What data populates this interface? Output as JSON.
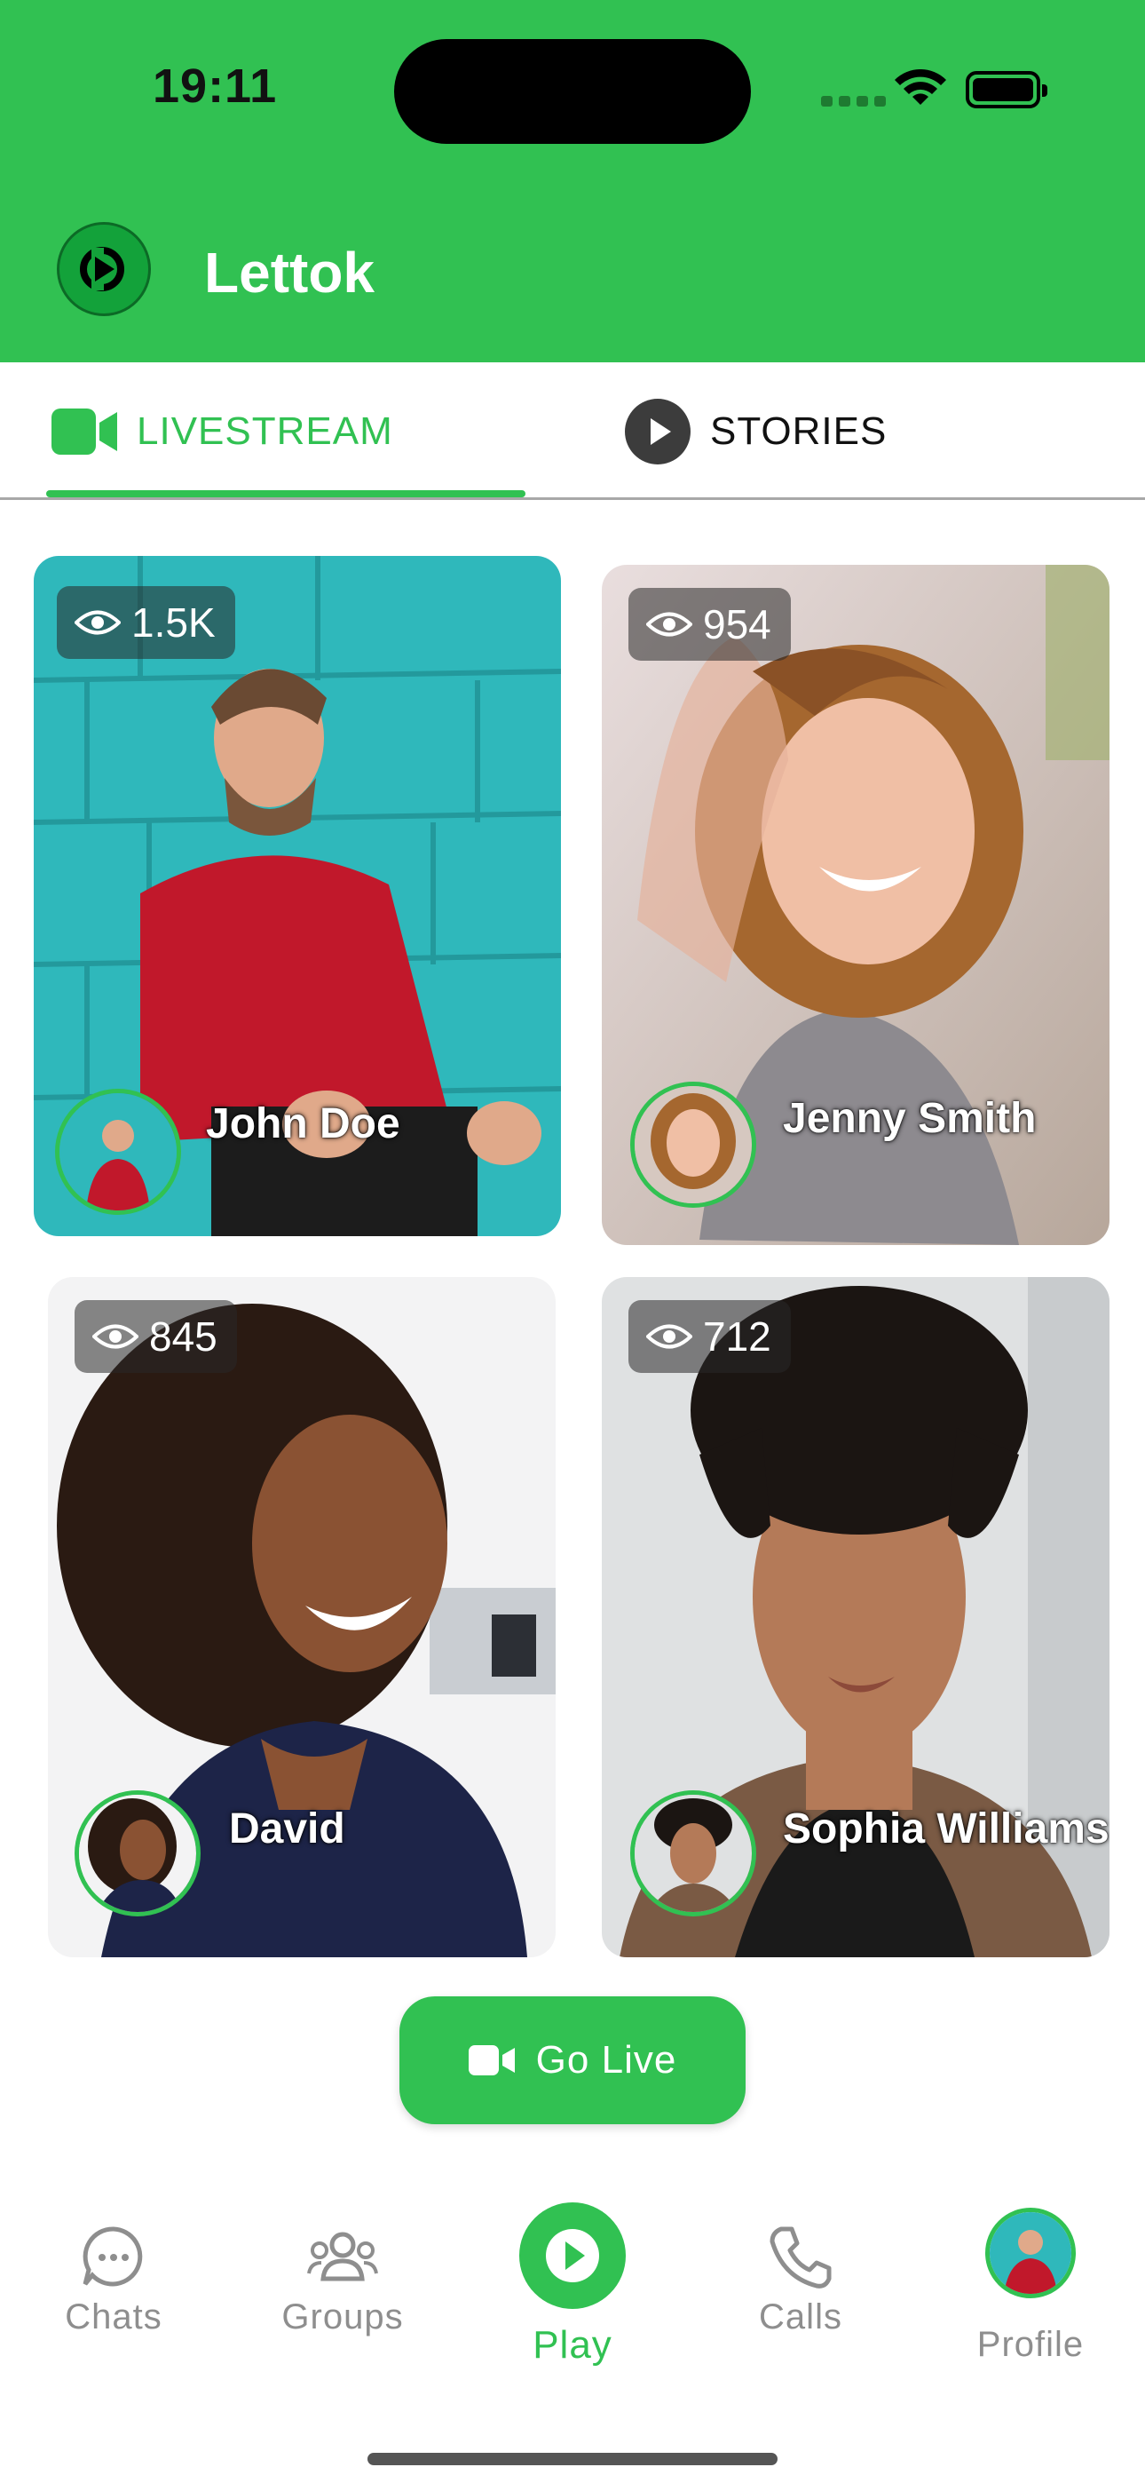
{
  "status_bar": {
    "time": "19:11"
  },
  "app": {
    "title": "Lettok"
  },
  "tabs": {
    "livestream": "LIVESTREAM",
    "stories": "STORIES",
    "active": "livestream"
  },
  "streams": [
    {
      "name": "John Doe",
      "views": "1.5K"
    },
    {
      "name": "Jenny Smith",
      "views": "954"
    },
    {
      "name": "David",
      "views": "845"
    },
    {
      "name": "Sophia Williams",
      "views": "712"
    }
  ],
  "go_live": {
    "label": "Go Live"
  },
  "bottom_nav": {
    "chats": "Chats",
    "groups": "Groups",
    "play": "Play",
    "calls": "Calls",
    "profile": "Profile",
    "active": "play"
  },
  "colors": {
    "accent": "#31c152",
    "text_inactive": "#8e8e8e"
  },
  "icons": [
    "eye-icon",
    "video-camera-icon",
    "play-icon",
    "chat-bubble-icon",
    "group-icon",
    "phone-icon",
    "wifi-icon",
    "battery-icon"
  ]
}
